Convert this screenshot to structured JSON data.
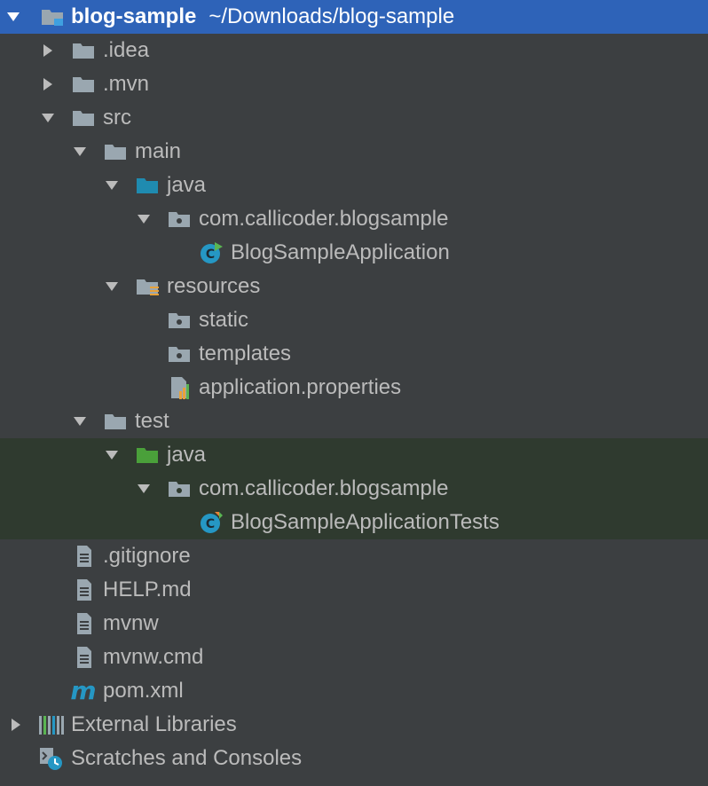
{
  "tree": {
    "root": {
      "name": "blog-sample",
      "path": "~/Downloads/blog-sample"
    },
    "idea": ".idea",
    "mvn": ".mvn",
    "src": "src",
    "main": "main",
    "main_java": "java",
    "main_package": "com.callicoder.blogsample",
    "main_class": "BlogSampleApplication",
    "resources": "resources",
    "static": "static",
    "templates": "templates",
    "properties": "application.properties",
    "test": "test",
    "test_java": "java",
    "test_package": "com.callicoder.blogsample",
    "test_class": "BlogSampleApplicationTests",
    "gitignore": ".gitignore",
    "help": "HELP.md",
    "mvnw": "mvnw",
    "mvnw_cmd": "mvnw.cmd",
    "pom": "pom.xml",
    "external_libraries": "External Libraries",
    "scratches": "Scratches and Consoles"
  },
  "colors": {
    "background": "#3c3f41",
    "selection": "#2e63b8",
    "test_background": "#2f3a2f",
    "folder": "#9aa7b0",
    "source_folder": "#1f8bb0",
    "test_folder": "#4aa03a",
    "text": "#bbbbbb"
  }
}
